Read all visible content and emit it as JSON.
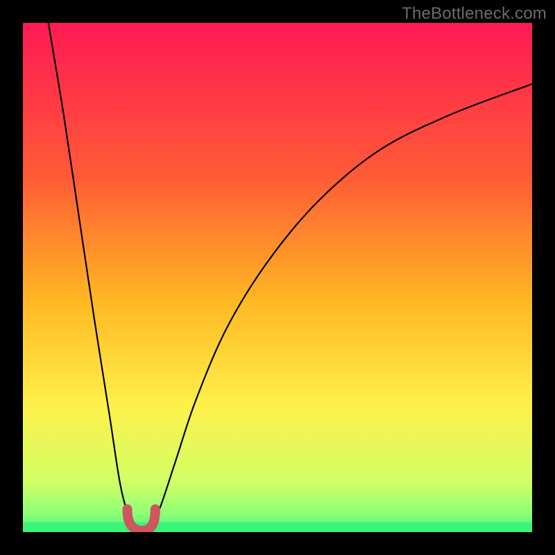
{
  "watermark": "TheBottleneck.com",
  "chart_data": {
    "type": "line",
    "title": "",
    "xlabel": "",
    "ylabel": "",
    "xlim": [
      0,
      100
    ],
    "ylim": [
      0,
      100
    ],
    "series": [
      {
        "name": "bottleneck-curve",
        "x": [
          5,
          8,
          11,
          14,
          17,
          19,
          20.5,
          22,
          23.5,
          25,
          27,
          30,
          34,
          40,
          48,
          58,
          70,
          84,
          100
        ],
        "values": [
          100,
          82,
          62,
          42,
          23,
          10,
          4,
          1,
          0,
          1,
          5,
          14,
          26,
          40,
          53,
          65,
          75,
          82,
          88
        ]
      }
    ],
    "trough_x_range": [
      20.5,
      26
    ],
    "trough_min_x": 23.5,
    "background": {
      "type": "vertical-gradient",
      "stops": [
        {
          "offset": 0.0,
          "color": "#ff1a54"
        },
        {
          "offset": 0.3,
          "color": "#ff5a36"
        },
        {
          "offset": 0.55,
          "color": "#ffb923"
        },
        {
          "offset": 0.75,
          "color": "#fff04a"
        },
        {
          "offset": 0.9,
          "color": "#d2ff66"
        },
        {
          "offset": 0.965,
          "color": "#8cff76"
        },
        {
          "offset": 1.0,
          "color": "#38f47a"
        }
      ]
    }
  },
  "colors": {
    "frame": "#000000",
    "curve": "#000000",
    "trough_marker": "#cf5561",
    "bottom_band": "#38f47a",
    "watermark": "#6b6b6b"
  }
}
